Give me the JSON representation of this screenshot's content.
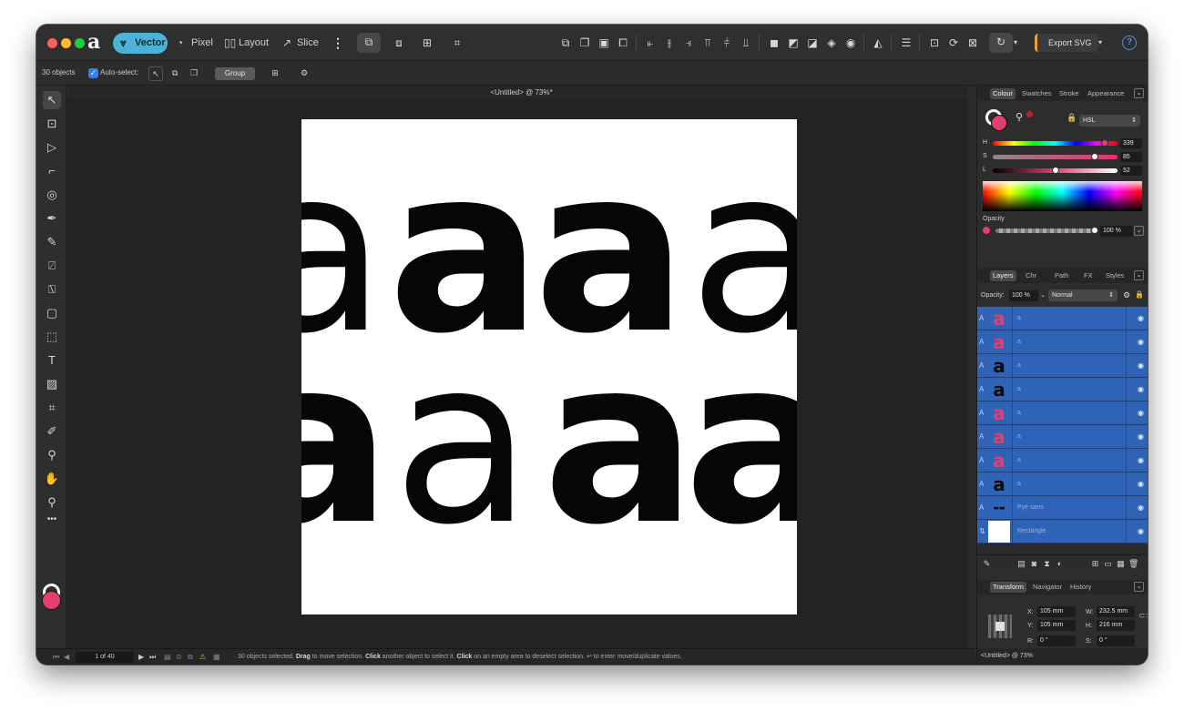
{
  "toolbar": {
    "personas": [
      {
        "label": "Vector",
        "icon": "vector-persona-icon"
      },
      {
        "label": "Pixel",
        "icon": "pixel-persona-icon"
      },
      {
        "label": "Layout",
        "icon": "layout-persona-icon"
      },
      {
        "label": "Slice",
        "icon": "slice-persona-icon"
      }
    ],
    "export_label": "Export SVG",
    "help_label": "?"
  },
  "context": {
    "objects_count": "30 objects",
    "auto_select_label": "Auto-select:",
    "group_label": "Group"
  },
  "document": {
    "title": "<Untitled> @ 73%*",
    "glyph": "a"
  },
  "status": {
    "page": "1 of 40",
    "lead": "30 objects selected.",
    "drag": "Drag",
    "drag_rest": "to move selection.",
    "click": "Click",
    "click_rest": "another object to select it.",
    "click2": "Click",
    "click2_rest": "on an empty area to deselect selection.",
    "tail": "↩ to enter move/duplicate values."
  },
  "colour_panel": {
    "tabs": [
      "Colour",
      "Swatches",
      "Stroke",
      "Appearance"
    ],
    "model": "HSL",
    "h_label": "H",
    "h_value": "339",
    "s_label": "S",
    "s_value": "85",
    "l_label": "L",
    "l_value": "52",
    "opacity_label": "Opacity",
    "opacity_value": "100 %",
    "fill_color": "#e2406c"
  },
  "layers_panel": {
    "tabs": [
      "Layers",
      "Chr",
      "Path",
      "FX",
      "Styles"
    ],
    "opacity_label": "Opacity:",
    "opacity_value": "100 %",
    "blend_mode": "Normal",
    "rows": [
      {
        "type": "A",
        "name": "a",
        "color": "#e2406c"
      },
      {
        "type": "A",
        "name": "a",
        "color": "#e2406c"
      },
      {
        "type": "A",
        "name": "a",
        "color": "#0a0a0a"
      },
      {
        "type": "A",
        "name": "a",
        "color": "#0a0a0a"
      },
      {
        "type": "A",
        "name": "a",
        "color": "#e2406c"
      },
      {
        "type": "A",
        "name": "a",
        "color": "#e2406c"
      },
      {
        "type": "A",
        "name": "a",
        "color": "#e2406c"
      },
      {
        "type": "A",
        "name": "a",
        "color": "#0a0a0a"
      },
      {
        "type": "A",
        "name": "Pye sans",
        "color": "#0a0a0a"
      },
      {
        "type": "⇅",
        "name": "Rectangle",
        "color": "#ffffff"
      }
    ]
  },
  "transform_panel": {
    "tabs": [
      "Transform",
      "Navigator",
      "History"
    ],
    "x_label": "X:",
    "x_value": "105 mm",
    "y_label": "Y:",
    "y_value": "105 mm",
    "w_label": "W:",
    "w_value": "232.5 mm",
    "h_label": "H:",
    "h_value": "216 mm",
    "r_label": "R:",
    "r_value": "0 °",
    "s_label": "S:",
    "s_value": "0 °"
  },
  "right_status": "<Untitled> @ 73%"
}
